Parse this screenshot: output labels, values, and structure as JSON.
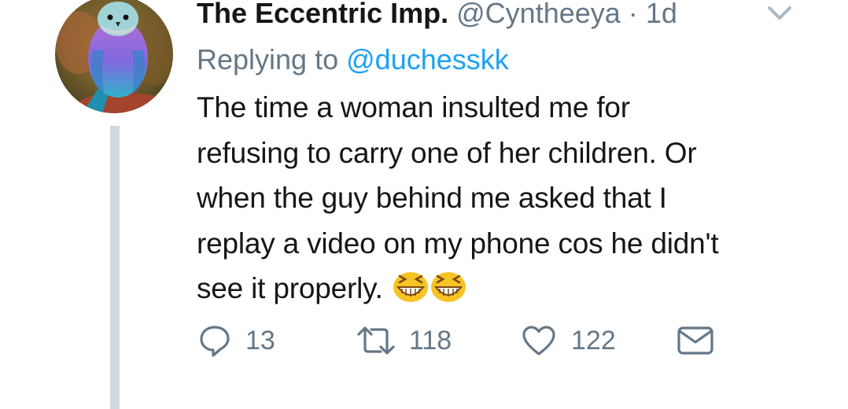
{
  "tweet": {
    "author": {
      "display_name": "The Eccentric Imp.",
      "handle": "@Cyntheeya",
      "separator": "·",
      "time": "1d"
    },
    "replying_prefix": "Replying to",
    "replying_mention": "@duchesskk",
    "text_lines": [
      "The time a woman insulted me for",
      "refusing to carry one of her children. Or",
      "when the guy behind me asked that I",
      "replay a video on my phone cos he didn't",
      "see it properly."
    ],
    "emoji": [
      "grinning-squinting-face",
      "grinning-squinting-face"
    ],
    "stats": {
      "replies": "13",
      "retweets": "118",
      "likes": "122"
    }
  },
  "icons": {
    "avatar": "bird-photo-avatar",
    "menu": "chevron-down-icon",
    "reply": "reply-icon",
    "retweet": "retweet-icon",
    "like": "heart-icon",
    "dm": "envelope-icon"
  },
  "colors": {
    "text": "#14171a",
    "secondary": "#657786",
    "link": "#1da1f2",
    "thread_line": "#cfd9de",
    "emoji": "#f7c325"
  }
}
